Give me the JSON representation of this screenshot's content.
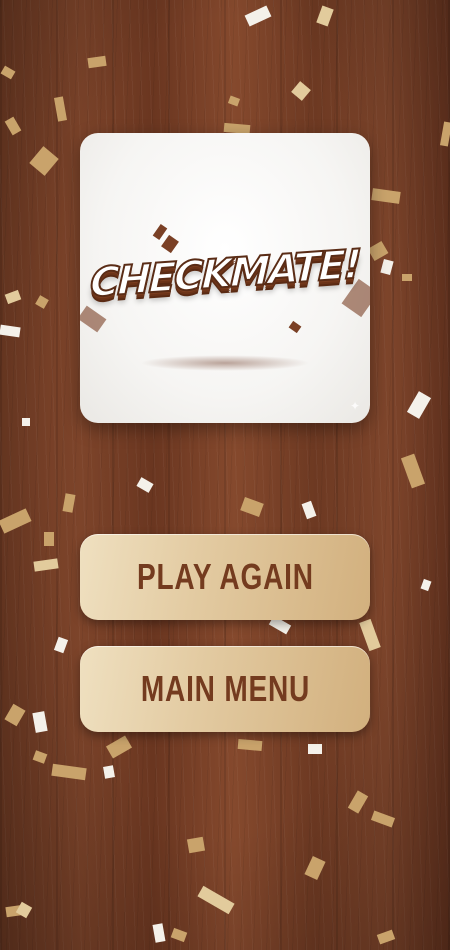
{
  "logo": {
    "text": "CHECKMATE!",
    "icon": "checkmate-logo"
  },
  "buttons": {
    "play_again": "PLAY AGAIN",
    "main_menu": "MAIN MENU"
  },
  "colors": {
    "wood": "#7a4228",
    "button": "#e3cba2",
    "button_text": "#743b1f",
    "confetti_gold": "#c9a36b",
    "confetti_white": "#f4f1ea"
  }
}
